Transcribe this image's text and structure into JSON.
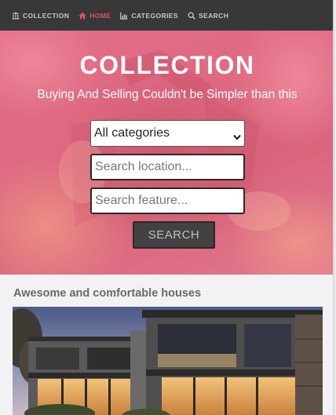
{
  "nav": {
    "items": [
      {
        "label": "COLLECTION",
        "icon": "bank-icon",
        "active": false
      },
      {
        "label": "HOME",
        "icon": "home-icon",
        "active": true
      },
      {
        "label": "CATEGORIES",
        "icon": "chart-icon",
        "active": false
      },
      {
        "label": "SEARCH",
        "icon": "search-icon",
        "active": false
      }
    ]
  },
  "hero": {
    "title": "COLLECTION",
    "subtitle": "Buying And Selling Couldn't be Simpler than this",
    "category_select": {
      "value": "All categories"
    },
    "location_input": {
      "placeholder": "Search location..."
    },
    "feature_input": {
      "placeholder": "Search feature..."
    },
    "search_button": "SEARCH"
  },
  "listing": {
    "heading": "Awesome and comfortable houses"
  },
  "colors": {
    "nav_bg": "#383838",
    "nav_active": "#e5506a",
    "hero_overlay": "#df6a82",
    "button_bg": "#424242"
  }
}
